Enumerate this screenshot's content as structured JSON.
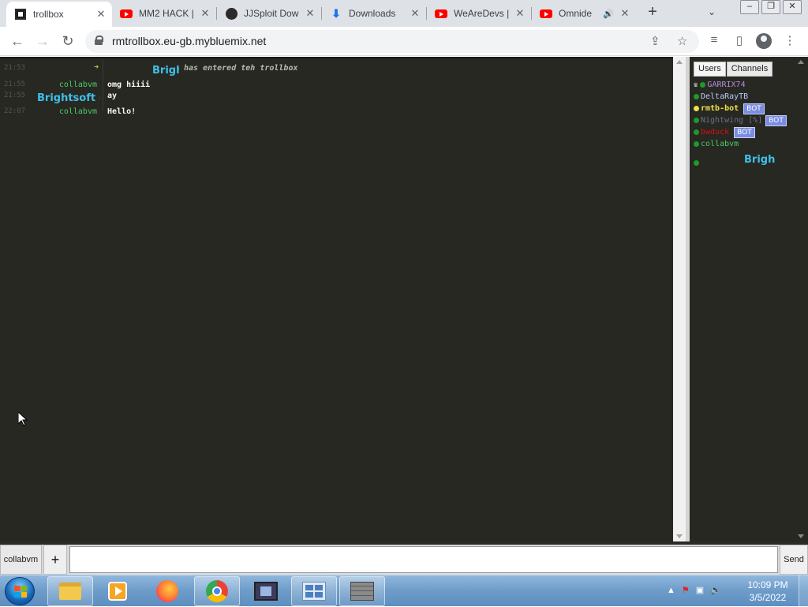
{
  "browser": {
    "tabs": [
      {
        "label": "trollbox",
        "icon": "trollbox-icon",
        "active": true
      },
      {
        "label": "MM2 HACK |",
        "icon": "youtube-icon"
      },
      {
        "label": "JJSploit Dow",
        "icon": "jjsploit-icon"
      },
      {
        "label": "Downloads",
        "icon": "download-icon"
      },
      {
        "label": "WeAreDevs |",
        "icon": "youtube-icon"
      },
      {
        "label": "Omnide",
        "icon": "youtube-icon",
        "audio": true
      }
    ],
    "url": "rmtrollbox.eu-gb.mybluemix.net"
  },
  "trollbox": {
    "messages": [
      {
        "time": "21:53",
        "nick": "Brigh",
        "nick_color": "#3ec0e8",
        "text": "has entered teh trollbox",
        "system": true
      },
      {
        "time": "21:55",
        "nick": "collabvm",
        "nick_color": "#4ec96a",
        "text": "omg hiiii"
      },
      {
        "time": "21:55",
        "nick": "Brightsoft (c",
        "nick_color": "#3ec0e8",
        "text": "ay"
      },
      {
        "time": "22:07",
        "nick": "collabvm",
        "nick_color": "#4ec96a",
        "text": "Hello!"
      }
    ],
    "panel_tabs": [
      "Users",
      "Channels"
    ],
    "users": [
      {
        "name": "GARRIX74",
        "color": "#b58ad9",
        "dot": "#1e9a2a",
        "crown": true
      },
      {
        "name": "DeltaRayTB",
        "color": "#b8c8ff",
        "dot": "#1e9a2a"
      },
      {
        "name": "rmtb-bot",
        "color": "#f0e04a",
        "dot": "#f0e04a",
        "bot": "BOT"
      },
      {
        "name": "Nightwing [%]",
        "color": "#6a6f8a",
        "dot": "#1e9a2a",
        "bot": "BOT"
      },
      {
        "name": "bwduck",
        "color": "#d01010",
        "dot": "#1e9a2a",
        "bot": "BOT"
      },
      {
        "name": "collabvm",
        "color": "#4ec96a",
        "dot": "#1e9a2a"
      },
      {
        "name": "Brigh",
        "color": "#3ec0e8",
        "dot": "#1e9a2a",
        "big": true
      }
    ],
    "input": {
      "nick_button": "collabvm",
      "plus": "+",
      "value": "",
      "send": "Send"
    }
  },
  "taskbar": {
    "apps": [
      "explorer-icon",
      "media-player-icon",
      "firefox-icon",
      "chrome-icon",
      "movie-maker-icon",
      "control-panel-icon",
      "firewall-icon"
    ],
    "time": "10:09 PM",
    "date": "3/5/2022"
  }
}
